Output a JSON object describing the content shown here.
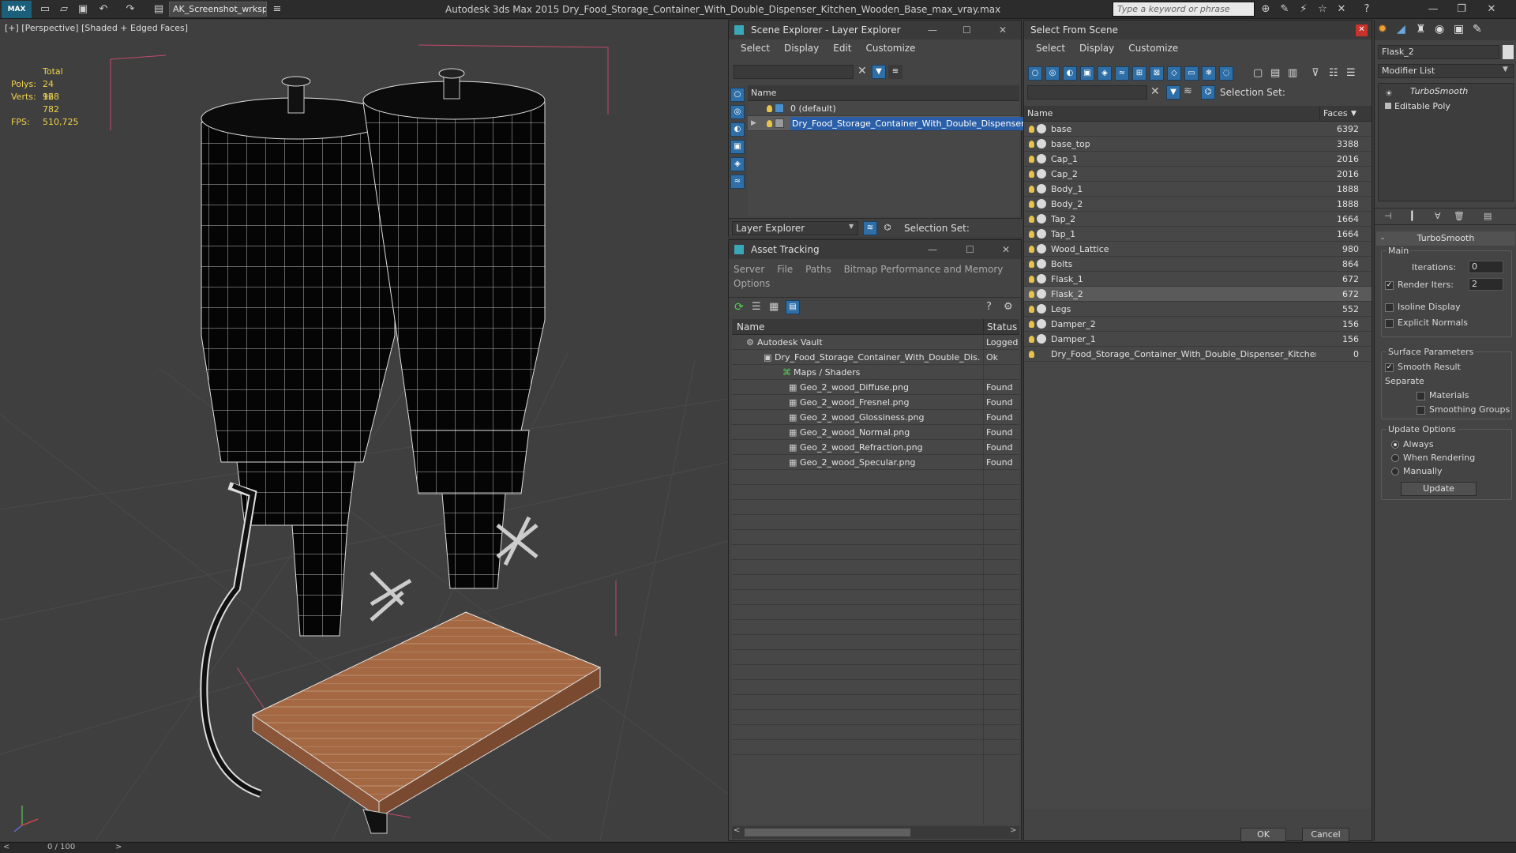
{
  "titlebar": {
    "logo": "MAX",
    "workspace": "AK_Screenshot_wrksp",
    "title": "Autodesk 3ds Max  2015    Dry_Food_Storage_Container_With_Double_Dispenser_Kitchen_Wooden_Base_max_vray.max",
    "search_placeholder": "Type a keyword or phrase"
  },
  "viewport": {
    "label": "[+] [Perspective] [Shaded + Edged Faces]",
    "stats": {
      "total_label": "Total",
      "polys_label": "Polys:",
      "polys": "24 968",
      "verts_label": "Verts:",
      "verts": "12 782",
      "fps_label": "FPS:",
      "fps": "510,725"
    }
  },
  "timeline": {
    "frame": "0 / 100",
    "prev": "<",
    "next": ">"
  },
  "scene_explorer": {
    "title": "Scene Explorer - Layer Explorer",
    "menu": [
      "Select",
      "Display",
      "Edit",
      "Customize"
    ],
    "col_name": "Name",
    "rows": [
      {
        "label": "0 (default)"
      },
      {
        "label": "Dry_Food_Storage_Container_With_Double_Dispenser_K..."
      }
    ],
    "footer_combo": "Layer Explorer",
    "selection_set": "Selection Set:"
  },
  "asset_tracking": {
    "title": "Asset Tracking",
    "menu": [
      "Server",
      "File",
      "Paths",
      "Bitmap Performance and Memory",
      "Options"
    ],
    "col_name": "Name",
    "col_status": "Status",
    "rows": [
      {
        "name": "Autodesk Vault",
        "status": "Logged"
      },
      {
        "name": "Dry_Food_Storage_Container_With_Double_Dis...",
        "status": "Ok"
      },
      {
        "name": "Maps / Shaders",
        "status": ""
      },
      {
        "name": "Geo_2_wood_Diffuse.png",
        "status": "Found"
      },
      {
        "name": "Geo_2_wood_Fresnel.png",
        "status": "Found"
      },
      {
        "name": "Geo_2_wood_Glossiness.png",
        "status": "Found"
      },
      {
        "name": "Geo_2_wood_Normal.png",
        "status": "Found"
      },
      {
        "name": "Geo_2_wood_Refraction.png",
        "status": "Found"
      },
      {
        "name": "Geo_2_wood_Specular.png",
        "status": "Found"
      }
    ]
  },
  "select_from_scene": {
    "title": "Select From Scene",
    "menu": [
      "Select",
      "Display",
      "Customize"
    ],
    "selection_set": "Selection Set:",
    "col_name": "Name",
    "col_faces": "Faces",
    "rows": [
      {
        "name": "base",
        "faces": "6392"
      },
      {
        "name": "base_top",
        "faces": "3388"
      },
      {
        "name": "Cap_1",
        "faces": "2016"
      },
      {
        "name": "Cap_2",
        "faces": "2016"
      },
      {
        "name": "Body_1",
        "faces": "1888"
      },
      {
        "name": "Body_2",
        "faces": "1888"
      },
      {
        "name": "Tap_2",
        "faces": "1664"
      },
      {
        "name": "Tap_1",
        "faces": "1664"
      },
      {
        "name": "Wood_Lattice",
        "faces": "980"
      },
      {
        "name": "Bolts",
        "faces": "864"
      },
      {
        "name": "Flask_1",
        "faces": "672"
      },
      {
        "name": "Flask_2",
        "faces": "672"
      },
      {
        "name": "Legs",
        "faces": "552"
      },
      {
        "name": "Damper_2",
        "faces": "156"
      },
      {
        "name": "Damper_1",
        "faces": "156"
      },
      {
        "name": "Dry_Food_Storage_Container_With_Double_Dispenser_Kitchen_W...",
        "faces": "0"
      }
    ],
    "ok": "OK",
    "cancel": "Cancel"
  },
  "command_panel": {
    "object_name": "Flask_2",
    "modifier_list": "Modifier List",
    "stack": [
      "TurboSmooth",
      "Editable Poly"
    ],
    "rollout_title": "TurboSmooth",
    "main_label": "Main",
    "iterations_label": "Iterations:",
    "iterations": "0",
    "render_iters_label": "Render Iters:",
    "render_iters": "2",
    "isoline": "Isoline Display",
    "explicit_normals": "Explicit Normals",
    "surface_params": "Surface Parameters",
    "smooth_result": "Smooth Result",
    "separate": "Separate",
    "materials": "Materials",
    "smoothing_groups": "Smoothing Groups",
    "update_options": "Update Options",
    "always": "Always",
    "when_rendering": "When Rendering",
    "manually": "Manually",
    "update_btn": "Update"
  }
}
